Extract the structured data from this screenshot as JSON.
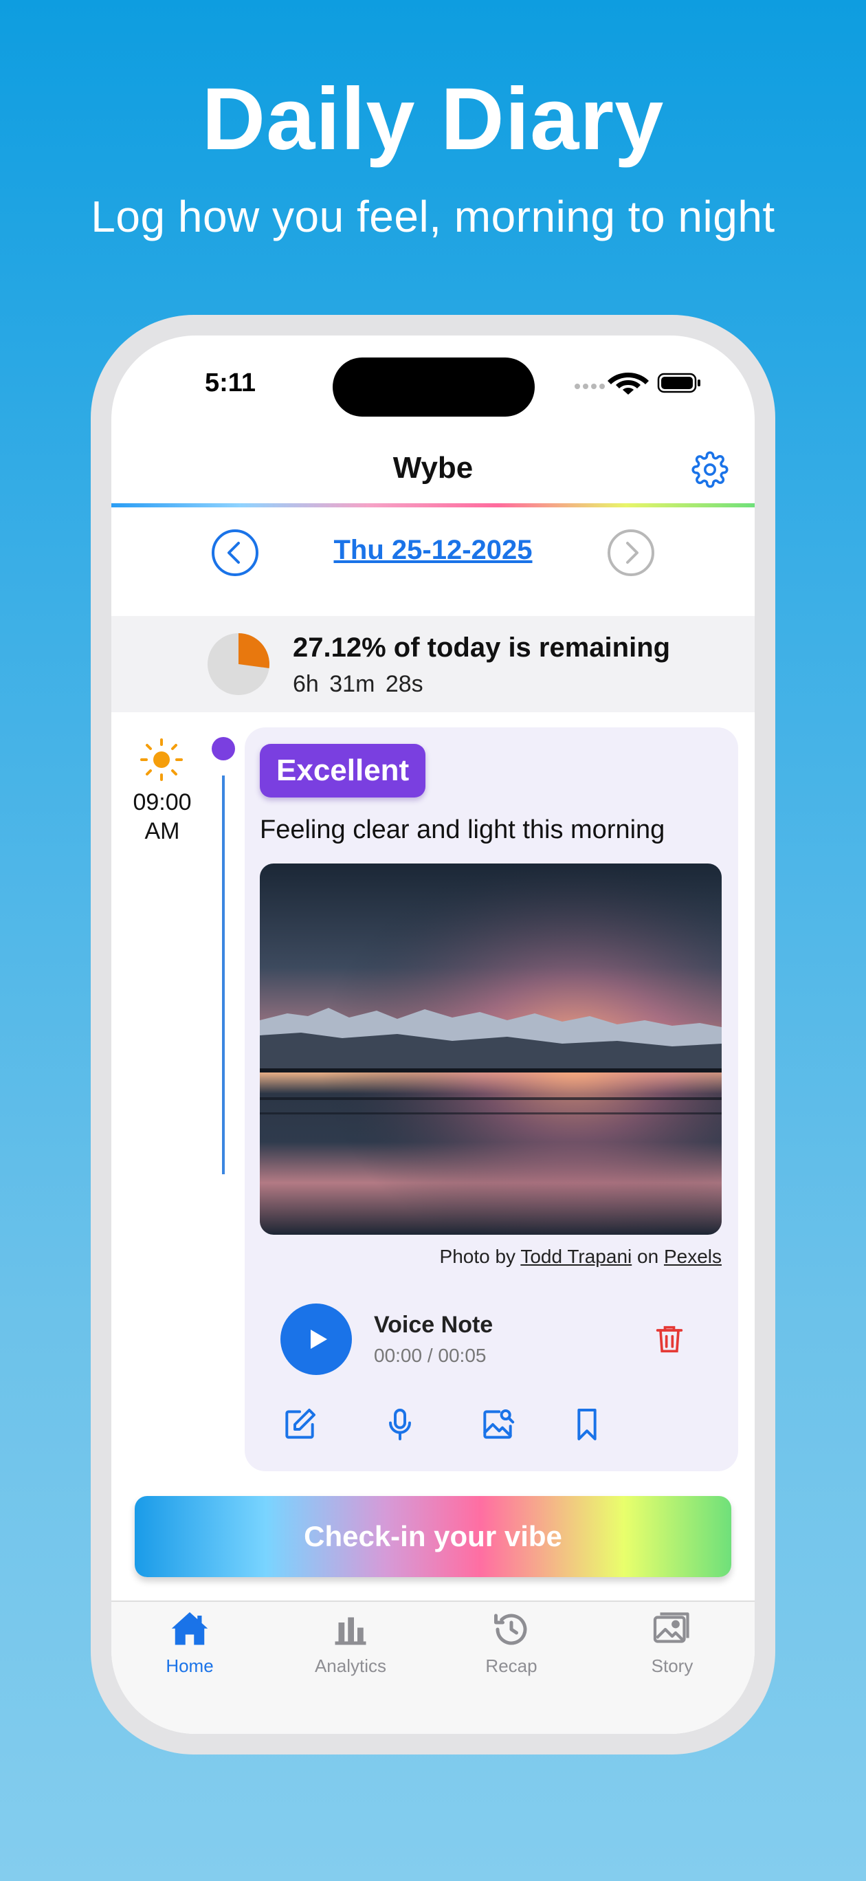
{
  "promo": {
    "headline": "Daily Diary",
    "subline": "Log how you feel, morning to night"
  },
  "status_bar": {
    "time": "5:11",
    "icons": [
      "signal-icon",
      "wifi-icon",
      "battery-icon"
    ]
  },
  "header": {
    "title": "Wybe",
    "settings_icon": "gear-icon"
  },
  "date_nav": {
    "date": "Thu 25-12-2025",
    "prev_icon": "chevron-left-icon",
    "next_icon": "chevron-right-icon"
  },
  "day_progress": {
    "title": "27.12% of today is remaining",
    "time_left": "6h  31m  28s",
    "remaining_fraction": 0.2712
  },
  "entry": {
    "time": "09:00 AM",
    "period_icon": "sun-icon",
    "mood": "Excellent",
    "text": "Feeling clear and light this morning",
    "photo_credit": {
      "prefix": "Photo by",
      "author": "Todd Trapani",
      "middle": "on",
      "source": "Pexels"
    },
    "voice_note": {
      "title": "Voice Note",
      "time": "00:00 / 00:05"
    },
    "actions": [
      "edit-icon",
      "microphone-icon",
      "image-search-icon",
      "bookmark-icon"
    ]
  },
  "checkin_button": "Check-in your vibe",
  "tabs": [
    {
      "label": "Home",
      "icon": "home-icon",
      "active": true
    },
    {
      "label": "Analytics",
      "icon": "bar-chart-icon",
      "active": false
    },
    {
      "label": "Recap",
      "icon": "history-icon",
      "active": false
    },
    {
      "label": "Story",
      "icon": "gallery-icon",
      "active": false
    }
  ],
  "colors": {
    "accent": "#1a73e8",
    "mood_excellent": "#7a3fe0",
    "delete": "#e53935",
    "sun": "#f59e0b",
    "pie_fill": "#e8780e"
  }
}
